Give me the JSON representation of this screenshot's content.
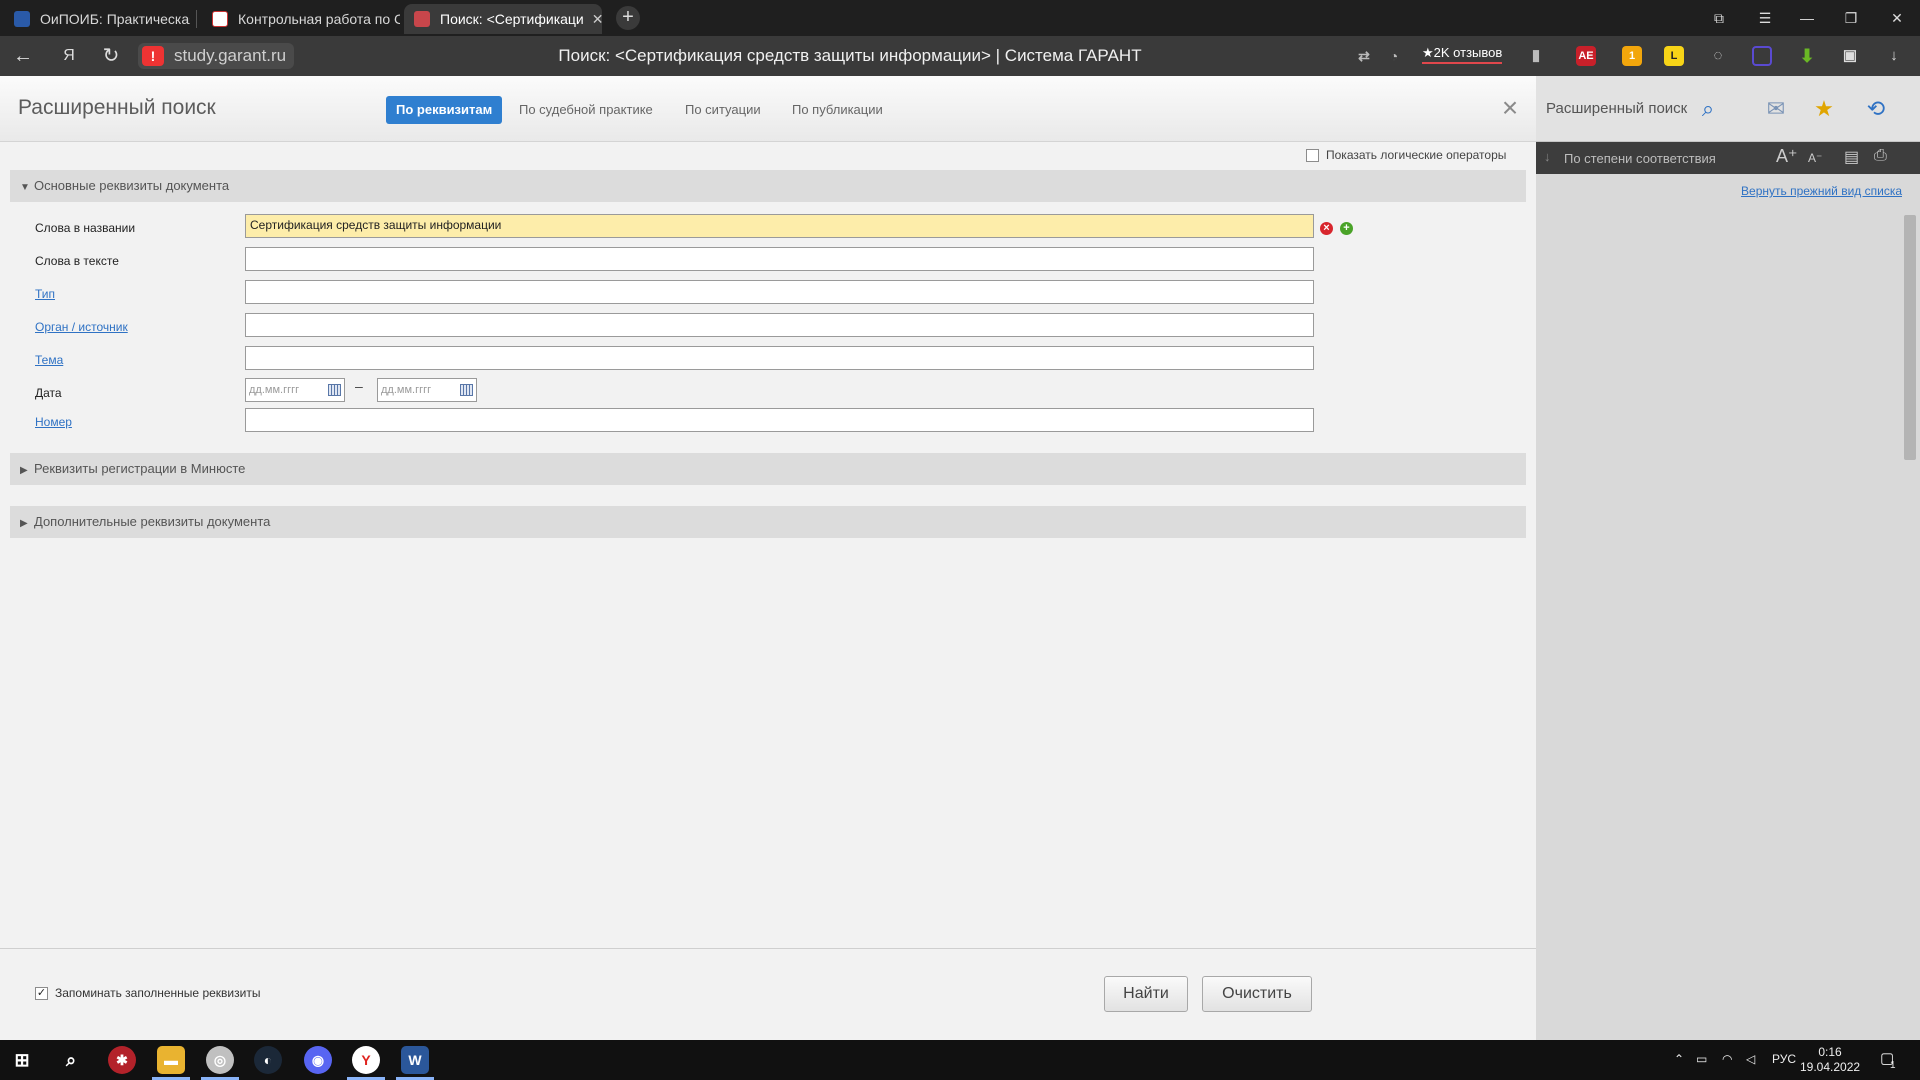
{
  "browser": {
    "tabs": [
      {
        "label": "ОиПОИБ: Практическая р"
      },
      {
        "label": "Контрольная работа по С"
      },
      {
        "label": "Поиск: <Сертификаци"
      }
    ],
    "url": "study.garant.ru",
    "page_title": "Поиск: <Сертификация средств защиты информации> | Система ГАРАНТ",
    "reviews_label": "★2K отзывов",
    "ext_badges": {
      "ae": "AE",
      "kb": "1"
    }
  },
  "search": {
    "title": "Расширенный поиск",
    "tabs": [
      "По реквизитам",
      "По судебной практике",
      "По ситуации",
      "По публикации"
    ],
    "show_logic_ops": "Показать логические операторы",
    "sections": {
      "basic": "Основные реквизиты документа",
      "minjust": "Реквизиты регистрации в Минюсте",
      "extra": "Дополнительные реквизиты документа"
    },
    "fields": {
      "title_words_label": "Слова в названии",
      "title_words_value": "Сертификация средств защиты информации",
      "text_words_label": "Слова в тексте",
      "type_label": "Тип",
      "organ_label": "Орган / источник",
      "topic_label": "Тема",
      "date_label": "Дата",
      "date_from_placeholder": "дд.мм.гггг",
      "date_to_placeholder": "дд.мм.гггг",
      "date_sep": "–",
      "number_label": "Номер"
    },
    "remember_label": "Запоминать заполненные реквизиты",
    "find_button": "Найти",
    "clear_button": "Очистить"
  },
  "right_panel": {
    "title": "Расширенный поиск",
    "sort_label": "По степени соответствия",
    "restore_link": "Вернуть прежний вид списка"
  },
  "taskbar": {
    "lang": "РУС",
    "time": "0:16",
    "date": "19.04.2022",
    "notif_count": "1"
  },
  "colors": {
    "accent": "#2f7fd0",
    "filled_field": "#fdedaa",
    "link": "#2f72c4"
  }
}
